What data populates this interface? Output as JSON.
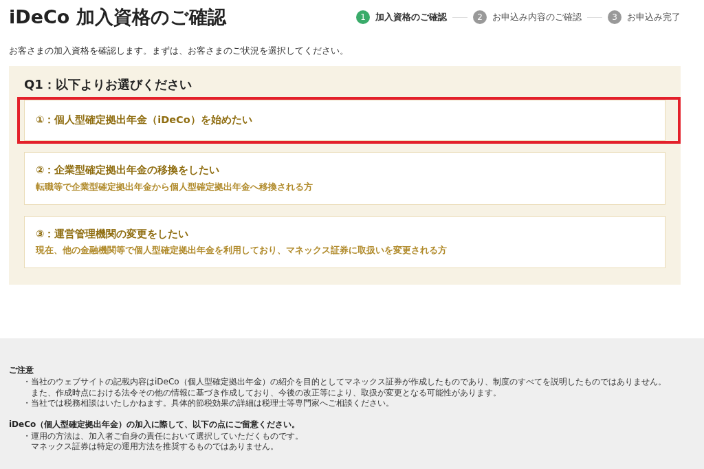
{
  "page_title": "iDeCo 加入資格のご確認",
  "steps": [
    {
      "number": "1",
      "label": "加入資格のご確認",
      "selected": true
    },
    {
      "number": "2",
      "label": "お申込み内容のご確認",
      "selected": false
    },
    {
      "number": "3",
      "label": "お申込み完了",
      "selected": false
    }
  ],
  "intro": "お客さまの加入資格を確認します。まずは、お客さまのご状況を選択してください。",
  "question": "Q1：以下よりお選びください",
  "options": [
    {
      "title": "①：個人型確定拠出年金（iDeCo）を始めたい",
      "highlighted": true
    },
    {
      "title": "②：企業型確定拠出年金の移換をしたい",
      "description": "転職等で企業型確定拠出年金から個人型確定拠出年金へ移換される方",
      "highlighted": false
    },
    {
      "title": "③：運営管理機関の変更をしたい",
      "description": "現在、他の金融機関等で個人型確定拠出年金を利用しており、マネックス証券に取扱いを変更される方",
      "highlighted": false
    }
  ],
  "notes": [
    {
      "heading": "ご注意",
      "bullets": [
        {
          "lines": [
            "・当社のウェブサイトの記載内容はiDeCo（個人型確定拠出年金）の紹介を目的としてマネックス証券が作成したものであり、制度のすべてを説明したものではありません。",
            "また、作成時点における法令その他の情報に基づき作成しており、今後の改正等により、取扱が変更となる可能性があります。"
          ]
        },
        {
          "lines": [
            "・当社では税務相談はいたしかねます。具体的節税効果の詳細は税理士等専門家へご相談ください。"
          ]
        }
      ]
    },
    {
      "heading": "iDeCo（個人型確定拠出年金）の加入に際して、以下の点にご留意ください。",
      "bullets": [
        {
          "lines": [
            "・運用の方法は、加入者ご自身の責任において選択していただくものです。",
            "マネックス証券は特定の運用方法を推奨するものではありません。"
          ]
        }
      ]
    }
  ]
}
